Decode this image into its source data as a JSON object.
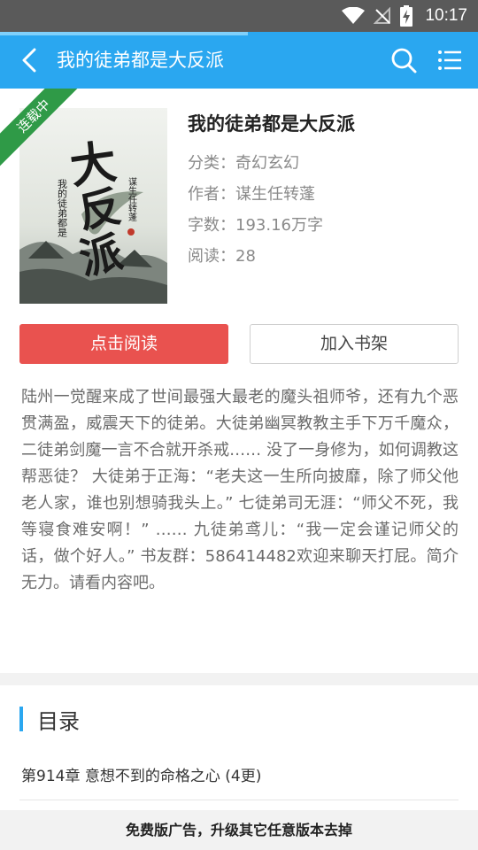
{
  "status_bar": {
    "time": "10:17",
    "icons": [
      "wifi-icon",
      "no-signal-icon",
      "battery-charging-icon"
    ]
  },
  "toolbar": {
    "title": "我的徒弟都是大反派",
    "back_icon": "chevron-left-icon",
    "search_icon": "search-icon",
    "menu_icon": "list-menu-icon"
  },
  "colors": {
    "toolbar": "#2aa7f0",
    "status_bar": "#5a5a5a",
    "read_button": "#e9524f",
    "ribbon": "#2f9a47",
    "toc_accent": "#2aa7f0"
  },
  "book": {
    "ribbon": "连载中",
    "cover": {
      "title_glyphs": "大反派",
      "subtitle": "我的徒弟都是",
      "author": "谋生任转蓬"
    },
    "title": "我的徒弟都是大反派",
    "category": "分类：奇幻玄幻",
    "author": "作者：谋生任转蓬",
    "words": "字数：193.16万字",
    "reads": "阅读：28"
  },
  "actions": {
    "read_label": "点击阅读",
    "shelf_label": "加入书架"
  },
  "intro": "陆州一觉醒来成了世间最强大最老的魔头祖师爷，还有九个恶贯满盈，威震天下的徒弟。大徒弟幽冥教教主手下万千魔众，二徒弟剑魔一言不合就开杀戒…… 没了一身修为，如何调教这帮恶徒？ 大徒弟于正海：“老夫这一生所向披靡，除了师父他老人家，谁也别想骑我头上。” 七徒弟司无涯：“师父不死，我等寝食难安啊！” …… 九徒弟鸢儿：“我一定会谨记师父的话，做个好人。” 书友群：586414482欢迎来聊天打屁。简介无力。请看内容吧。",
  "toc": {
    "title": "目录",
    "latest_chapter": "第914章 意想不到的命格之心 (4更)"
  },
  "ad": {
    "text": "免费版广告，升级其它任意版本去掉"
  }
}
